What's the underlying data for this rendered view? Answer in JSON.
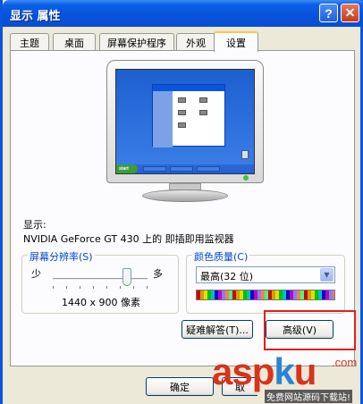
{
  "window": {
    "title": "显示 属性"
  },
  "titlebar": {
    "help_glyph": "?",
    "close_glyph": "✕"
  },
  "tabs": [
    {
      "label": "主题"
    },
    {
      "label": "桌面"
    },
    {
      "label": "屏幕保护程序"
    },
    {
      "label": "外观"
    },
    {
      "label": "设置",
      "active": true
    }
  ],
  "display": {
    "label": "显示:",
    "value": "NVIDIA GeForce GT 430 上的 即插即用监视器"
  },
  "resolution": {
    "title": "屏幕分辨率(S)",
    "less": "少",
    "more": "多",
    "value": "1440 x 900 像素",
    "slider_position": 0.78
  },
  "color_quality": {
    "title": "颜色质量(C)",
    "selected": "最高(32 位)"
  },
  "buttons": {
    "troubleshoot": "疑难解答(T)...",
    "advanced": "高级(V)",
    "ok": "确定",
    "cancel": "取"
  },
  "mini_screen": {
    "start_label": "start"
  },
  "watermark": {
    "asp": "asp",
    "k": "k",
    "u": "u",
    "com": ".com",
    "sub": "免费网站源码下载站!"
  },
  "colors": {
    "title_blue": "#0653db",
    "panel_bg": "#fcfcfe",
    "group_title": "#0046d5",
    "highlight_red": "#e0201a"
  }
}
